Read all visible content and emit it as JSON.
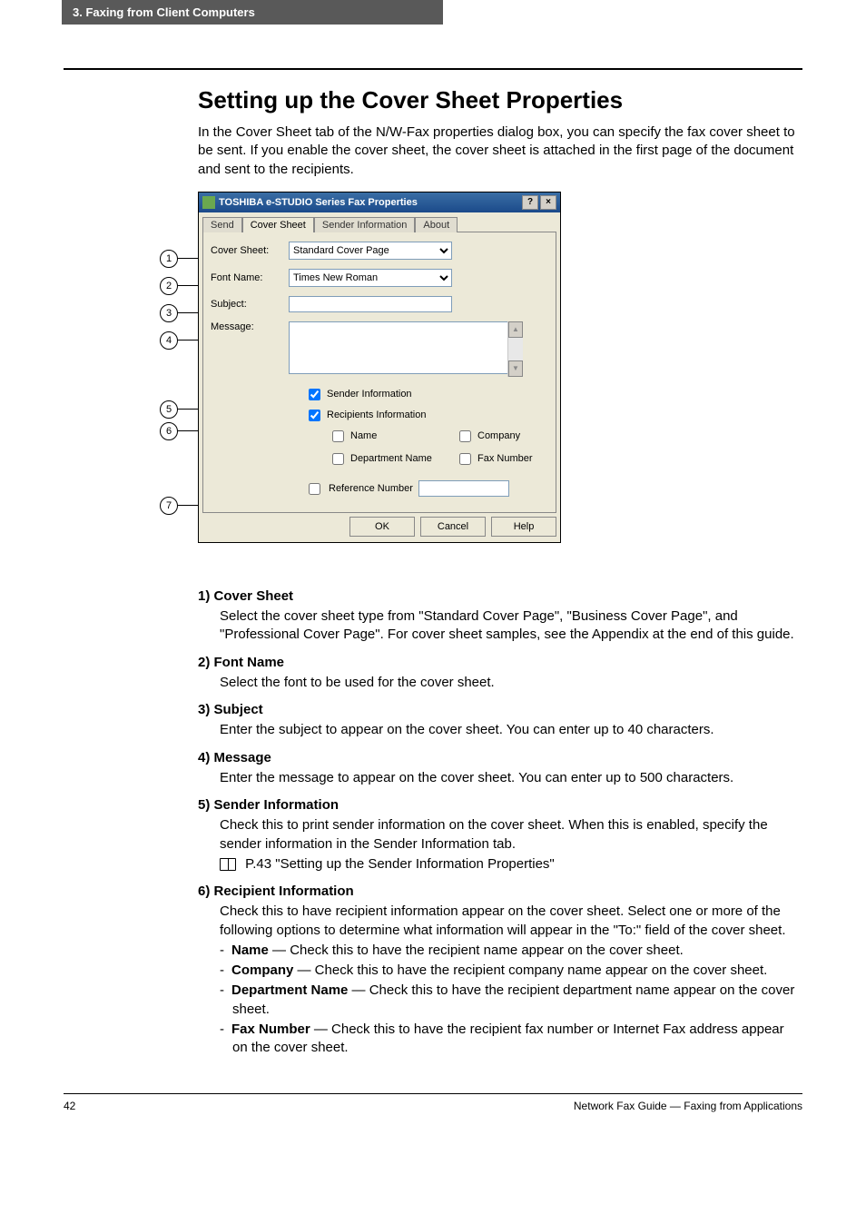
{
  "header": {
    "chapter": "3.  Faxing from Client Computers"
  },
  "title": "Setting up the Cover Sheet Properties",
  "intro": "In the Cover Sheet tab of the N/W-Fax properties dialog box, you can specify the fax cover sheet to be sent.  If you enable the cover sheet, the cover sheet is attached in the first page of the document and sent to the recipients.",
  "callouts": [
    "1",
    "2",
    "3",
    "4",
    "5",
    "6",
    "7"
  ],
  "dialog": {
    "title": "TOSHIBA e-STUDIO Series Fax Properties",
    "help_btn": "?",
    "close_btn": "×",
    "tabs": {
      "send": "Send",
      "cover_sheet": "Cover Sheet",
      "sender_info": "Sender Information",
      "about": "About"
    },
    "labels": {
      "cover_sheet": "Cover Sheet:",
      "font_name": "Font Name:",
      "subject": "Subject:",
      "message": "Message:",
      "sender_info": "Sender Information",
      "recipients_info": "Recipients Information",
      "name": "Name",
      "company": "Company",
      "dept": "Department Name",
      "fax": "Fax Number",
      "ref_num": "Reference Number"
    },
    "values": {
      "cover_sheet": "Standard Cover Page",
      "font_name": "Times New Roman",
      "subject": "",
      "message": "",
      "ref_num": ""
    },
    "checked": {
      "sender_info": true,
      "recipients_info": true,
      "name": false,
      "company": false,
      "dept": false,
      "fax": false,
      "ref_num": false
    },
    "buttons": {
      "ok": "OK",
      "cancel": "Cancel",
      "help": "Help"
    }
  },
  "items": {
    "i1": {
      "title": "1)  Cover Sheet",
      "body": "Select the cover sheet type from \"Standard Cover Page\", \"Business Cover Page\", and \"Professional Cover Page\".  For cover sheet samples, see the Appendix at the end of this guide."
    },
    "i2": {
      "title": "2)  Font Name",
      "body": "Select the font to be used for the cover sheet."
    },
    "i3": {
      "title": "3)  Subject",
      "body": "Enter the subject to appear on the cover sheet.  You can enter up to 40 characters."
    },
    "i4": {
      "title": "4)  Message",
      "body": "Enter the message to appear on the cover sheet.  You can enter up to 500 characters."
    },
    "i5": {
      "title": "5)  Sender Information",
      "body": "Check this to print sender information on the cover sheet.  When this is enabled, specify the sender information in the Sender Information tab.",
      "ref": "P.43 \"Setting up the Sender Information Properties\""
    },
    "i6": {
      "title": "6)  Recipient Information",
      "body": "Check this to have recipient information appear on the cover sheet.  Select one or more of the following options to determine what information will appear in the \"To:\" field of the cover sheet.",
      "sub": {
        "name_t": "Name",
        "name_b": " — Check this to have the recipient name appear on the cover sheet.",
        "company_t": "Company",
        "company_b": " — Check this to have the recipient company name appear on the cover sheet.",
        "dept_t": "Department Name",
        "dept_b": " — Check this to have the recipient department name appear on the cover sheet.",
        "fax_t": "Fax Number",
        "fax_b": " — Check this to have the recipient fax number or Internet Fax address appear on the cover sheet."
      }
    }
  },
  "footer": {
    "page": "42",
    "right": "Network Fax Guide — Faxing from Applications"
  }
}
